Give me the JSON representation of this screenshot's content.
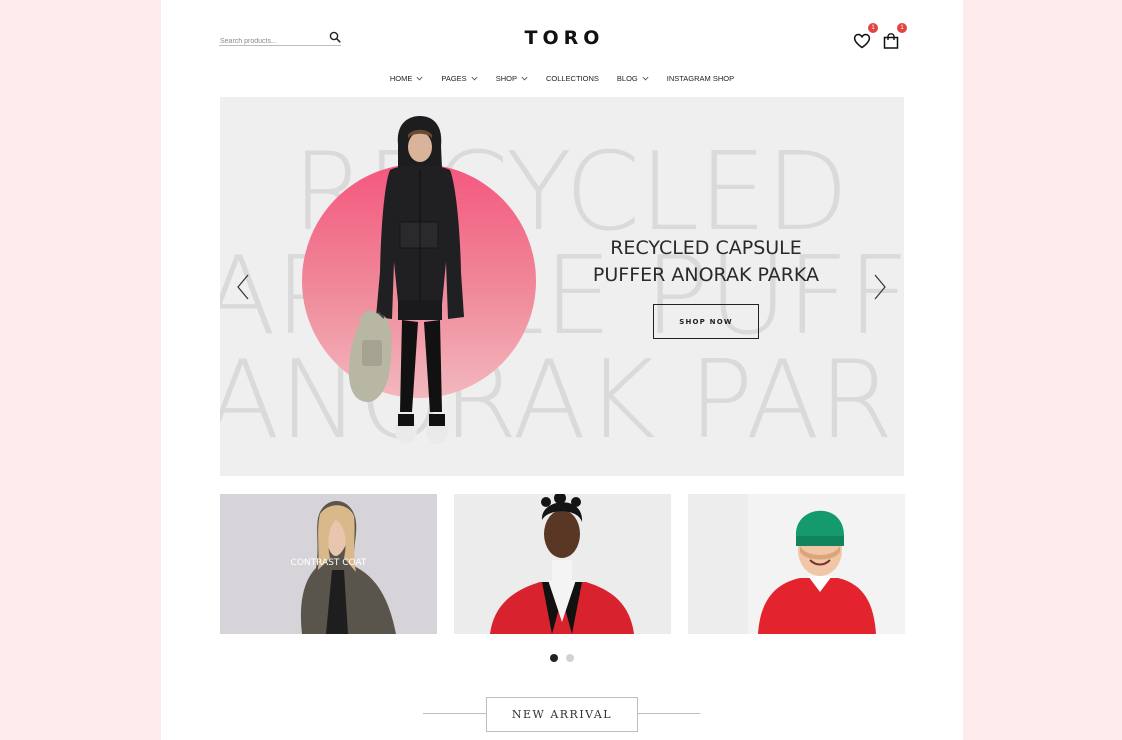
{
  "header": {
    "search_placeholder": "Search products...",
    "logo": "TORO",
    "wishlist_count": "1",
    "cart_count": "1"
  },
  "nav": {
    "items": [
      {
        "label": "HOME",
        "has_dropdown": true
      },
      {
        "label": "PAGES",
        "has_dropdown": true
      },
      {
        "label": "SHOP",
        "has_dropdown": true
      },
      {
        "label": "COLLECTIONS",
        "has_dropdown": false
      },
      {
        "label": "BLOG",
        "has_dropdown": true
      },
      {
        "label": "INSTAGRAM SHOP",
        "has_dropdown": false
      }
    ]
  },
  "hero": {
    "bg_line1": "RECYCLED",
    "bg_line2": "APSULE PUFFE",
    "bg_line3": "ANORAK PARKA",
    "title_line1": "RECYCLED CAPSULE",
    "title_line2": "PUFFER ANORAK PARKA",
    "button": "SHOP NOW"
  },
  "cards": [
    {
      "label": "CONTRAST COAT"
    },
    {
      "label": ""
    },
    {
      "label": ""
    }
  ],
  "slider": {
    "dots": 2,
    "active_index": 0
  },
  "section": {
    "title": "NEW ARRIVAL"
  },
  "colors": {
    "page_bg": "#fdeaea",
    "accent_pink": "#f4577e",
    "badge_red": "#e0463f",
    "text_dark": "#222222"
  }
}
